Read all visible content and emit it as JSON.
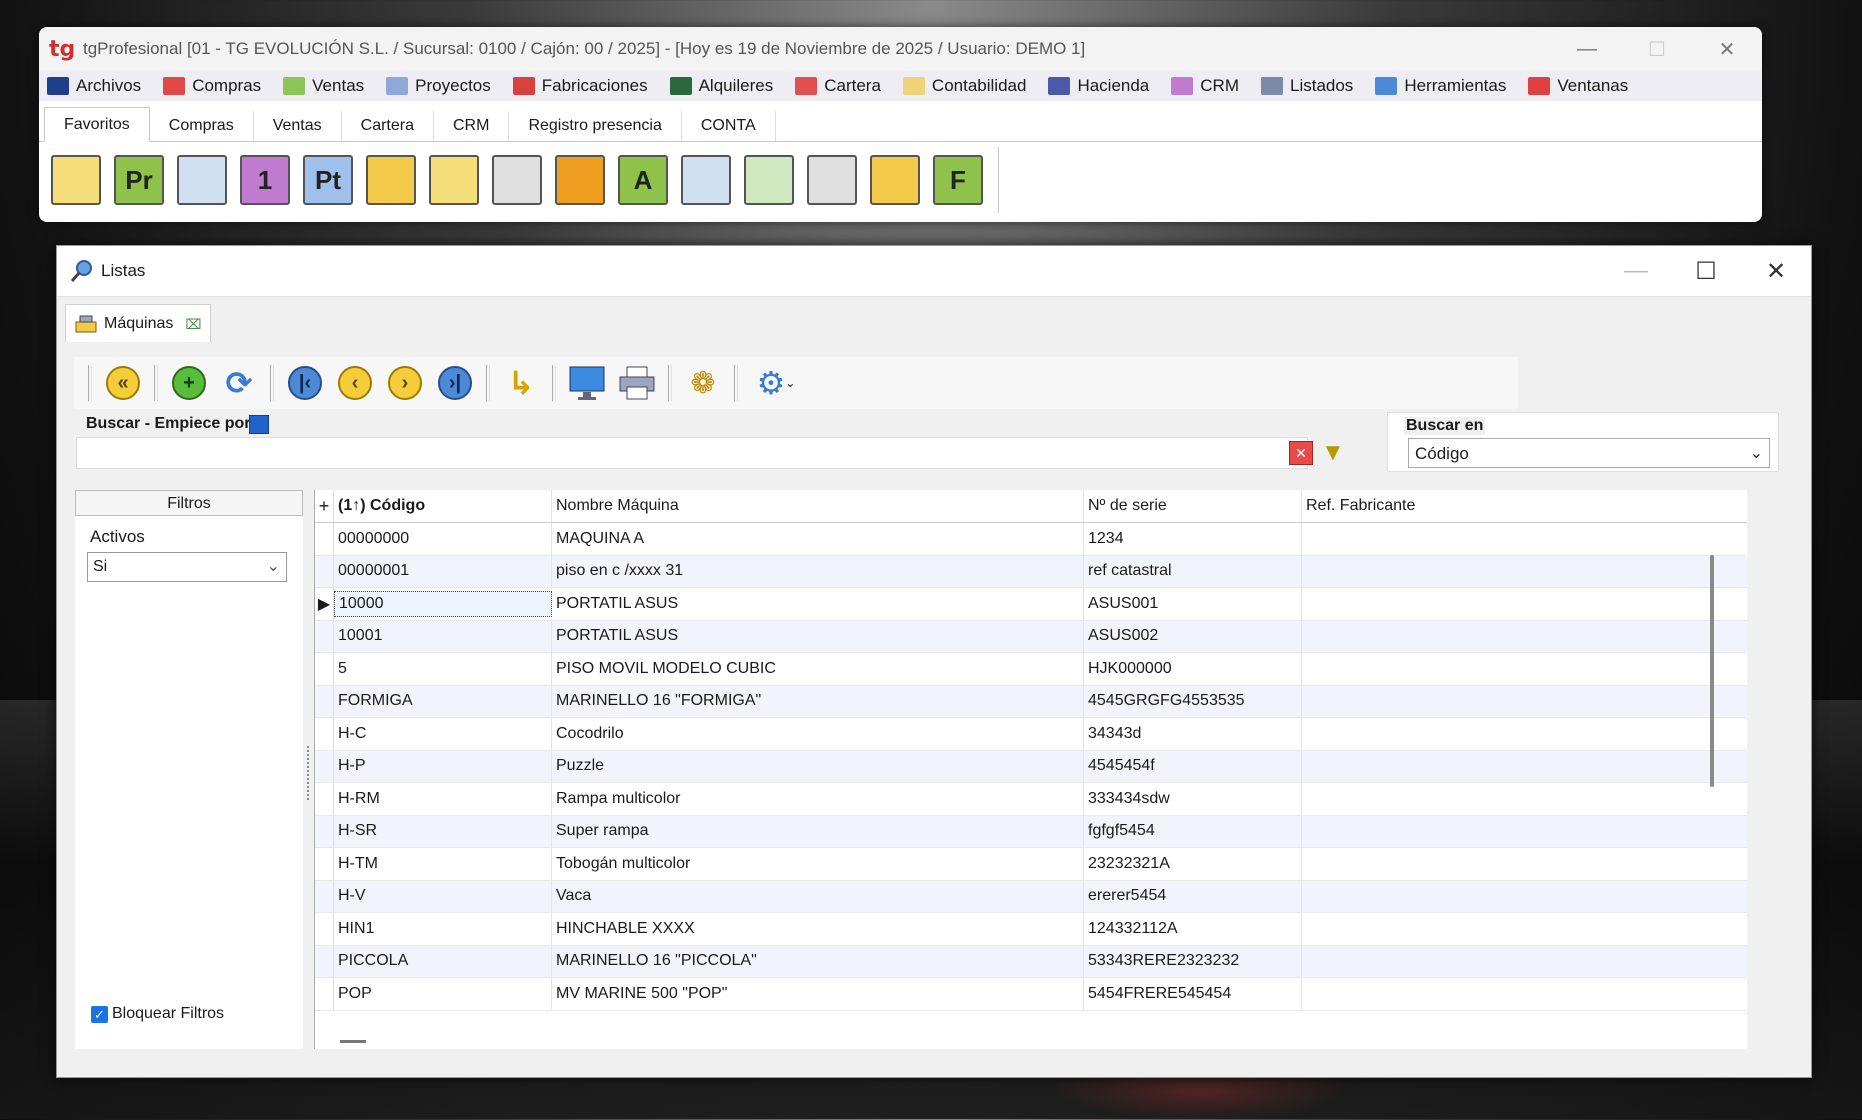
{
  "app": {
    "logo": "tg",
    "title": "tgProfesional [01 - TG EVOLUCIÓN S.L. / Sucursal: 0100 / Cajón: 00 / 2025] - [Hoy es 19 de Noviembre de 2025 / Usuario: DEMO 1]"
  },
  "menu": [
    {
      "label": "Archivos",
      "color": "#1f3f8a"
    },
    {
      "label": "Compras",
      "color": "#e04848"
    },
    {
      "label": "Ventas",
      "color": "#8cc65a"
    },
    {
      "label": "Proyectos",
      "color": "#8ea9d8"
    },
    {
      "label": "Fabricaciones",
      "color": "#d94040"
    },
    {
      "label": "Alquileres",
      "color": "#2a6a3a"
    },
    {
      "label": "Cartera",
      "color": "#e05050"
    },
    {
      "label": "Contabilidad",
      "color": "#f0d27a"
    },
    {
      "label": "Hacienda",
      "color": "#4a5aa8"
    },
    {
      "label": "CRM",
      "color": "#c07ad0"
    },
    {
      "label": "Listados",
      "color": "#7a8aa8"
    },
    {
      "label": "Herramientas",
      "color": "#4a8ad6"
    },
    {
      "label": "Ventanas",
      "color": "#e04040"
    }
  ],
  "ribbon_tabs": [
    "Favoritos",
    "Compras",
    "Ventas",
    "Cartera",
    "CRM",
    "Registro presencia",
    "CONTA"
  ],
  "ribbon_icons": [
    {
      "icon": "box-icon",
      "letter": "",
      "color": "#f5dd7a"
    },
    {
      "icon": "document-pr-icon",
      "letter": "Pr",
      "color": "#8fc24a"
    },
    {
      "icon": "presentation-icon",
      "letter": "",
      "color": "#cfe0f0"
    },
    {
      "icon": "calendar-icon",
      "letter": "1",
      "color": "#c07ad0"
    },
    {
      "icon": "document-pt-icon",
      "letter": "Pt",
      "color": "#9ec0ea"
    },
    {
      "icon": "machine-icon",
      "letter": "",
      "color": "#f5c94a"
    },
    {
      "icon": "box-icon",
      "letter": "",
      "color": "#f5dd7a"
    },
    {
      "icon": "cash-register-icon",
      "letter": "",
      "color": "#e0e0e0"
    },
    {
      "icon": "grid-icon",
      "letter": "",
      "color": "#f0a020"
    },
    {
      "icon": "document-a-icon",
      "letter": "A",
      "color": "#8fc24a"
    },
    {
      "icon": "presentation-icon",
      "letter": "",
      "color": "#cfe0f0"
    },
    {
      "icon": "user-icon",
      "letter": "",
      "color": "#d0e8c0"
    },
    {
      "icon": "cash-register-icon",
      "letter": "",
      "color": "#e0e0e0"
    },
    {
      "icon": "machine-icon",
      "letter": "",
      "color": "#f5c94a"
    },
    {
      "icon": "document-f-icon",
      "letter": "F",
      "color": "#8fc24a"
    }
  ],
  "lists_window": {
    "title": "Listas",
    "doc_tab": "Máquinas"
  },
  "search": {
    "label": "Buscar - Empiece por",
    "value": "",
    "search_in_label": "Buscar en",
    "search_in_value": "Código"
  },
  "filters": {
    "header": "Filtros",
    "active_label": "Activos",
    "active_value": "Si",
    "lock_label": "Bloquear Filtros"
  },
  "grid": {
    "add_symbol": "+",
    "columns": [
      "(1↑) Código",
      "Nombre Máquina",
      "Nº de serie",
      "Ref. Fabricante"
    ],
    "selected_row": 2,
    "rows": [
      [
        "00000000",
        "MAQUINA A",
        "1234",
        ""
      ],
      [
        "00000001",
        "piso en c /xxxx 31",
        "ref catastral",
        ""
      ],
      [
        "10000",
        "PORTATIL ASUS",
        "ASUS001",
        ""
      ],
      [
        "10001",
        "PORTATIL ASUS",
        "ASUS002",
        ""
      ],
      [
        "5",
        "PISO MOVIL MODELO CUBIC",
        "HJK000000",
        ""
      ],
      [
        "FORMIGA",
        "MARINELLO 16 \"FORMIGA\"",
        "4545GRGFG4553535",
        ""
      ],
      [
        "H-C",
        "Cocodrilo",
        "34343d",
        ""
      ],
      [
        "H-P",
        "Puzzle",
        "4545454f",
        ""
      ],
      [
        "H-RM",
        "Rampa multicolor",
        "333434sdw",
        ""
      ],
      [
        "H-SR",
        "Super rampa",
        "fgfgf5454",
        ""
      ],
      [
        "H-TM",
        "Tobogán multicolor",
        "23232321A",
        ""
      ],
      [
        "H-V",
        "Vaca",
        "ererer5454",
        ""
      ],
      [
        "HIN1",
        "HINCHABLE XXXX",
        "124332112A",
        ""
      ],
      [
        "PICCOLA",
        "MARINELLO 16 \"PICCOLA\"",
        "53343RERE2323232",
        ""
      ],
      [
        "POP",
        "MV MARINE 500 \"POP\"",
        "5454FRERE545454",
        ""
      ]
    ]
  }
}
